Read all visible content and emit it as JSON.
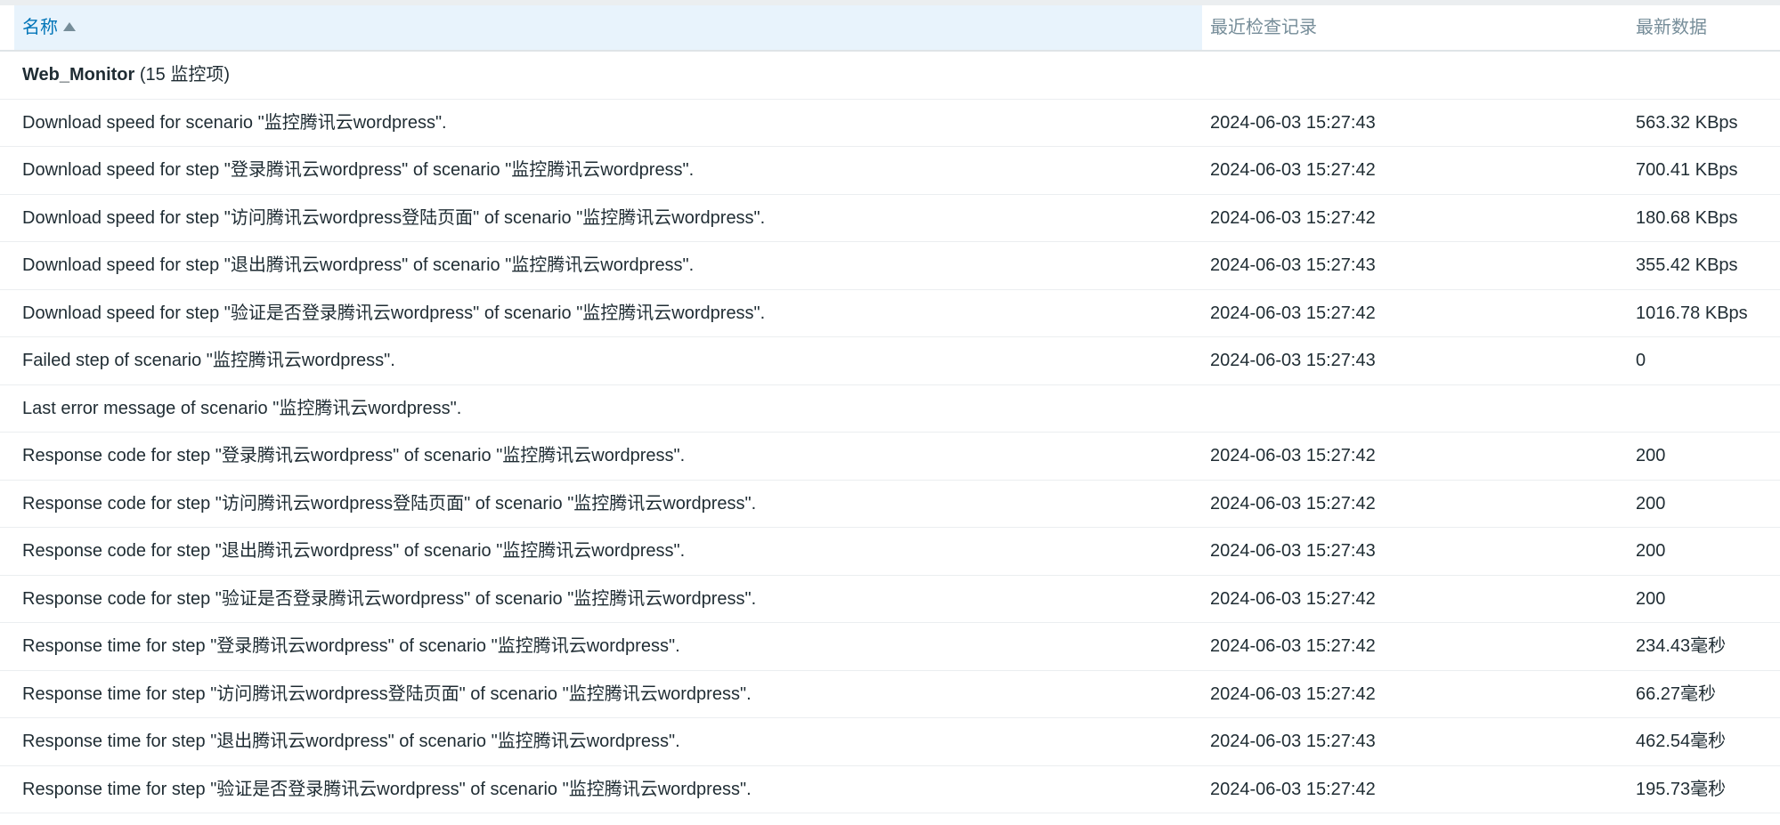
{
  "header": {
    "name_label": "名称",
    "check_label": "最近检查记录",
    "latest_label": "最新数据",
    "sort_icon": "sort-asc-icon"
  },
  "group": {
    "name": "Web_Monitor",
    "count": "(15 监控项)"
  },
  "items": [
    {
      "name": "Download speed for scenario \"监控腾讯云wordpress\".",
      "time": "2024-06-03 15:27:43",
      "value": "563.32 KBps"
    },
    {
      "name": "Download speed for step \"登录腾讯云wordpress\" of scenario \"监控腾讯云wordpress\".",
      "time": "2024-06-03 15:27:42",
      "value": "700.41 KBps"
    },
    {
      "name": "Download speed for step \"访问腾讯云wordpress登陆页面\" of scenario \"监控腾讯云wordpress\".",
      "time": "2024-06-03 15:27:42",
      "value": "180.68 KBps"
    },
    {
      "name": "Download speed for step \"退出腾讯云wordpress\" of scenario \"监控腾讯云wordpress\".",
      "time": "2024-06-03 15:27:43",
      "value": "355.42 KBps"
    },
    {
      "name": "Download speed for step \"验证是否登录腾讯云wordpress\" of scenario \"监控腾讯云wordpress\".",
      "time": "2024-06-03 15:27:42",
      "value": "1016.78 KBps"
    },
    {
      "name": "Failed step of scenario \"监控腾讯云wordpress\".",
      "time": "2024-06-03 15:27:43",
      "value": "0"
    },
    {
      "name": "Last error message of scenario \"监控腾讯云wordpress\".",
      "time": "",
      "value": ""
    },
    {
      "name": "Response code for step \"登录腾讯云wordpress\" of scenario \"监控腾讯云wordpress\".",
      "time": "2024-06-03 15:27:42",
      "value": "200"
    },
    {
      "name": "Response code for step \"访问腾讯云wordpress登陆页面\" of scenario \"监控腾讯云wordpress\".",
      "time": "2024-06-03 15:27:42",
      "value": "200"
    },
    {
      "name": "Response code for step \"退出腾讯云wordpress\" of scenario \"监控腾讯云wordpress\".",
      "time": "2024-06-03 15:27:43",
      "value": "200"
    },
    {
      "name": "Response code for step \"验证是否登录腾讯云wordpress\" of scenario \"监控腾讯云wordpress\".",
      "time": "2024-06-03 15:27:42",
      "value": "200"
    },
    {
      "name": "Response time for step \"登录腾讯云wordpress\" of scenario \"监控腾讯云wordpress\".",
      "time": "2024-06-03 15:27:42",
      "value": "234.43毫秒"
    },
    {
      "name": "Response time for step \"访问腾讯云wordpress登陆页面\" of scenario \"监控腾讯云wordpress\".",
      "time": "2024-06-03 15:27:42",
      "value": "66.27毫秒"
    },
    {
      "name": "Response time for step \"退出腾讯云wordpress\" of scenario \"监控腾讯云wordpress\".",
      "time": "2024-06-03 15:27:43",
      "value": "462.54毫秒"
    },
    {
      "name": "Response time for step \"验证是否登录腾讯云wordpress\" of scenario \"监控腾讯云wordpress\".",
      "time": "2024-06-03 15:27:42",
      "value": "195.73毫秒"
    }
  ]
}
